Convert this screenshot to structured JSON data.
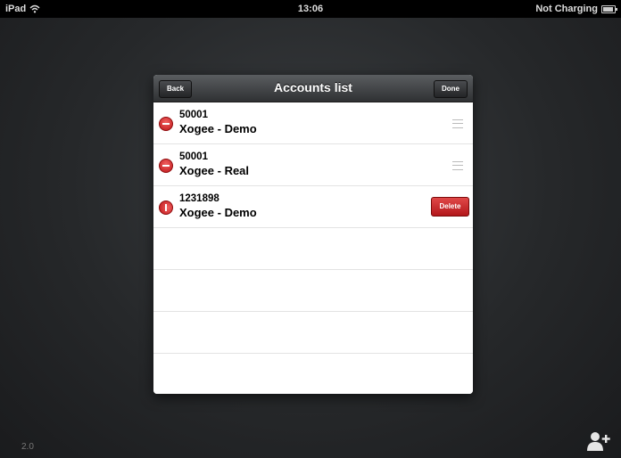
{
  "status_bar": {
    "device": "iPad",
    "time": "13:06",
    "battery_status": "Not Charging"
  },
  "modal": {
    "title": "Accounts list",
    "back_label": "Back",
    "done_label": "Done"
  },
  "accounts": [
    {
      "number": "50001",
      "name": "Xogee - Demo",
      "state": "edit"
    },
    {
      "number": "50001",
      "name": "Xogee - Real",
      "state": "edit"
    },
    {
      "number": "1231898",
      "name": "Xogee - Demo",
      "state": "confirm-delete"
    }
  ],
  "delete_label": "Delete",
  "version": "2.0",
  "colors": {
    "delete_red": "#c0171a",
    "navbar_dark": "#2f3133",
    "background": "#26282a"
  },
  "icons": [
    "wifi-icon",
    "battery-icon",
    "minus-circle-icon",
    "reorder-grip-icon",
    "add-user-icon"
  ]
}
